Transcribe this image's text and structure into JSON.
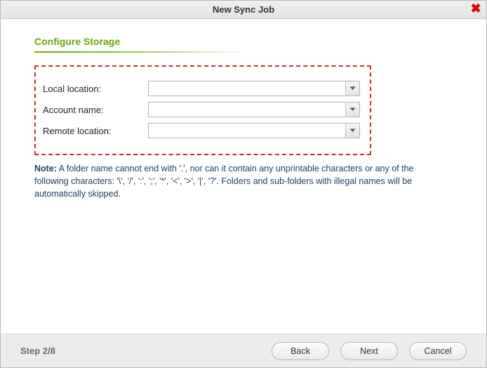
{
  "window": {
    "title": "New Sync Job"
  },
  "section": {
    "title": "Configure Storage"
  },
  "form": {
    "local_location_label": "Local location:",
    "local_location_value": "",
    "account_name_label": "Account name:",
    "account_name_value": "",
    "remote_location_label": "Remote location:",
    "remote_location_value": ""
  },
  "note": {
    "label": "Note:",
    "text": " A folder name cannot end with '.', nor can it contain any unprintable characters or any of the following characters: '\\', '/', ':', ';', '*', '<', '>', '|', '?'. Folders and sub-folders with illegal names will be automatically skipped."
  },
  "footer": {
    "step": "Step 2/8",
    "back": "Back",
    "next": "Next",
    "cancel": "Cancel"
  }
}
